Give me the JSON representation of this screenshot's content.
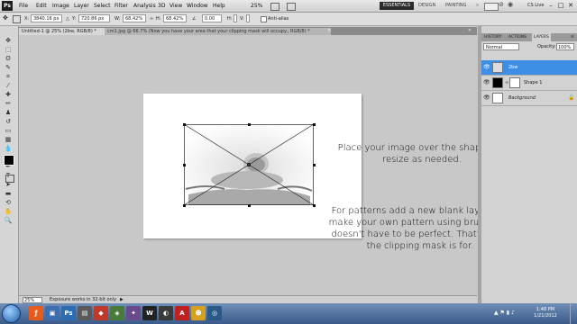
{
  "app": {
    "logo": "Ps"
  },
  "menubar": {
    "items": [
      "File",
      "Edit",
      "Image",
      "Layer",
      "Select",
      "Filter",
      "Analysis",
      "3D",
      "View",
      "Window",
      "Help"
    ],
    "zoom_label": "25%",
    "workspaces": [
      "ESSENTIALS",
      "DESIGN",
      "PAINTING"
    ],
    "more": "»",
    "cslive": "CS Live",
    "win_min": "–",
    "win_max": "□",
    "win_close": "✕"
  },
  "options": {
    "x_label": "X:",
    "x_value": "3840.16 px",
    "y_label": "Y:",
    "y_value": "720.86 px",
    "w_label": "W:",
    "w_value": "68.42%",
    "h_label": "H:",
    "h_value": "68.42%",
    "angle_value": "0.00",
    "antialias": "Anti-alias"
  },
  "tabs": [
    {
      "label": "Untitled-1 @ 25% (2bw, RGB/8) *"
    },
    {
      "label": "cm1.jpg @ 66.7% (Now you have your area that your clipping mask will occupy., RGB/8) *"
    }
  ],
  "canvas": {
    "instruction_1": "Place your image over the shape and resize as needed.",
    "instruction_2": "For patterns add a new blank layer and make your own pattern using brushes. It doesn't have to be perfect. That's what the clipping mask is for."
  },
  "status": {
    "zoom": "25%",
    "info": "Exposure works in 32-bit only"
  },
  "panel": {
    "tabs": [
      "HISTORY",
      "ACTIONS",
      "LAYERS"
    ],
    "blend_mode": "Normal",
    "opacity_label": "Opacity:",
    "opacity_value": "100%",
    "layers": [
      {
        "name": "2bw"
      },
      {
        "name": "Shape 1"
      },
      {
        "name": "Background"
      }
    ]
  },
  "taskbar": {
    "time": "1:48 PM",
    "date": "1/21/2012"
  },
  "colors": {
    "accent": "#3a8fe0",
    "selected_layer": "#3d8fe6"
  }
}
